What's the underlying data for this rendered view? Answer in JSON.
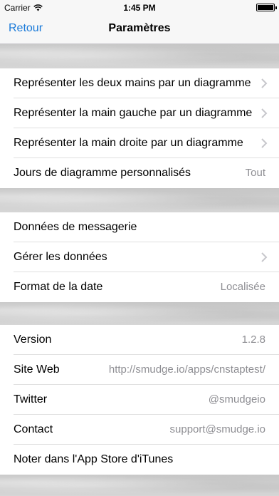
{
  "status_bar": {
    "carrier": "Carrier",
    "time": "1:45 PM"
  },
  "nav": {
    "back_label": "Retour",
    "title": "Paramètres"
  },
  "sections": [
    {
      "rows": [
        {
          "label": "Représenter les deux mains par un diagramme",
          "value": "",
          "chevron": true
        },
        {
          "label": "Représenter la main gauche par un diagramme",
          "value": "",
          "chevron": true
        },
        {
          "label": "Représenter la main droite par un diagramme",
          "value": "",
          "chevron": true
        },
        {
          "label": "Jours de diagramme personnalisés",
          "value": "Tout",
          "chevron": false
        }
      ]
    },
    {
      "rows": [
        {
          "label": "Données de messagerie",
          "value": "",
          "chevron": false
        },
        {
          "label": "Gérer les données",
          "value": "",
          "chevron": true
        },
        {
          "label": "Format de la date",
          "value": "Localisée",
          "chevron": false
        }
      ]
    },
    {
      "rows": [
        {
          "label": "Version",
          "value": "1.2.8",
          "chevron": false
        },
        {
          "label": "Site Web",
          "value": "http://smudge.io/apps/cnstaptest/",
          "chevron": false
        },
        {
          "label": "Twitter",
          "value": "@smudgeio",
          "chevron": false
        },
        {
          "label": "Contact",
          "value": "support@smudge.io",
          "chevron": false
        },
        {
          "label": "Noter dans l'App Store d'iTunes",
          "value": "",
          "chevron": false
        }
      ]
    }
  ]
}
